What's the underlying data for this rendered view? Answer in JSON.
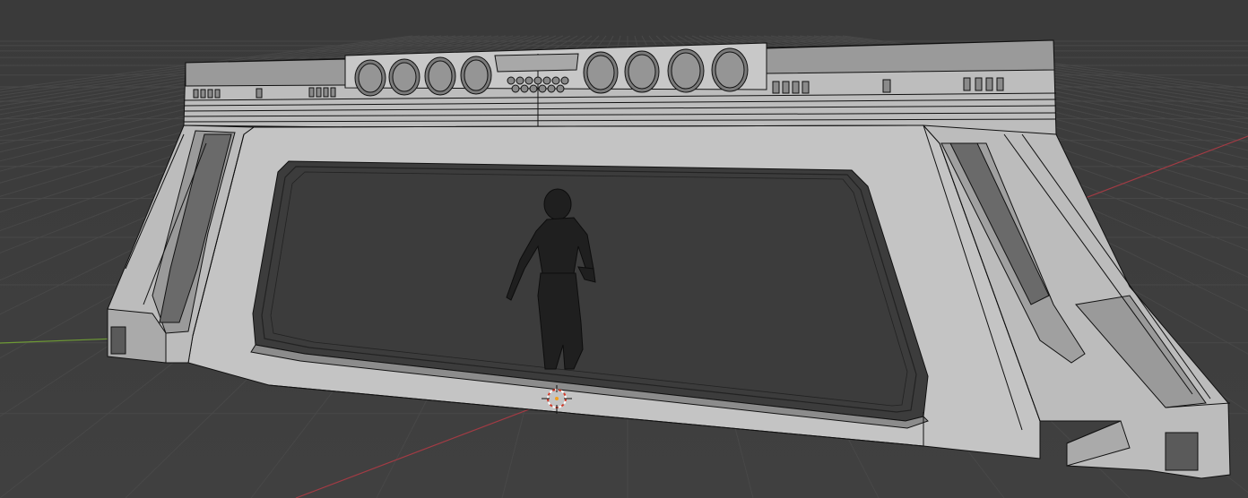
{
  "viewport": {
    "background": "#3d3d3d",
    "grid_color": "#484848",
    "x_axis_color": "#a33b44",
    "y_axis_color": "#6e9a35",
    "mesh_fill": "#c2c2c2",
    "mesh_shade": "#9e9e9e",
    "mesh_dark": "#6d6d6d",
    "wire_color": "#111111",
    "character_color": "#1e1e1e",
    "cursor_color": "#d03a2a"
  },
  "scene": {
    "objects": [
      "sci-fi-gate-mesh",
      "humanoid-character",
      "3d-cursor"
    ]
  }
}
